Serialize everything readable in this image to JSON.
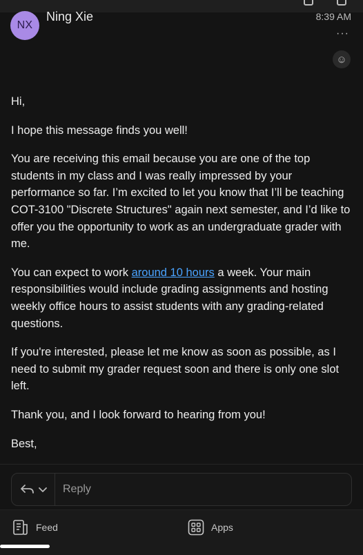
{
  "header": {
    "avatar_initials": "NX",
    "sender": "Ning Xie",
    "time": "8:39 AM",
    "more_label": "···",
    "react_icon": "smiley"
  },
  "message": {
    "greeting": "Hi,",
    "p1": "I hope this message finds you well!",
    "p2": "You are receiving this email because you are one of the top students in my class and I was really impressed by your performance so far.  I’m excited to let you know that I’ll be teaching COT-3100 \"Discrete Structures\" again next semester, and I’d like to offer you the opportunity to work as an undergraduate grader with me.",
    "p3_before": "You can expect to work ",
    "p3_link": "around 10 hours",
    "p3_after": " a week. Your main responsibilities would include grading assignments and hosting weekly office hours to assist students with any grading-related questions.",
    "p4": "If you're interested, please let me know as soon as possible, as I need to submit my grader request soon and there is only one slot left.",
    "p5": "Thank you, and I look forward to hearing from you!",
    "signoff": "Best,"
  },
  "reply": {
    "placeholder": "Reply"
  },
  "tabs": {
    "feed": "Feed",
    "apps": "Apps"
  },
  "colors": {
    "background": "#141414",
    "avatar": "#a98ae6",
    "link": "#4aa3ff"
  }
}
